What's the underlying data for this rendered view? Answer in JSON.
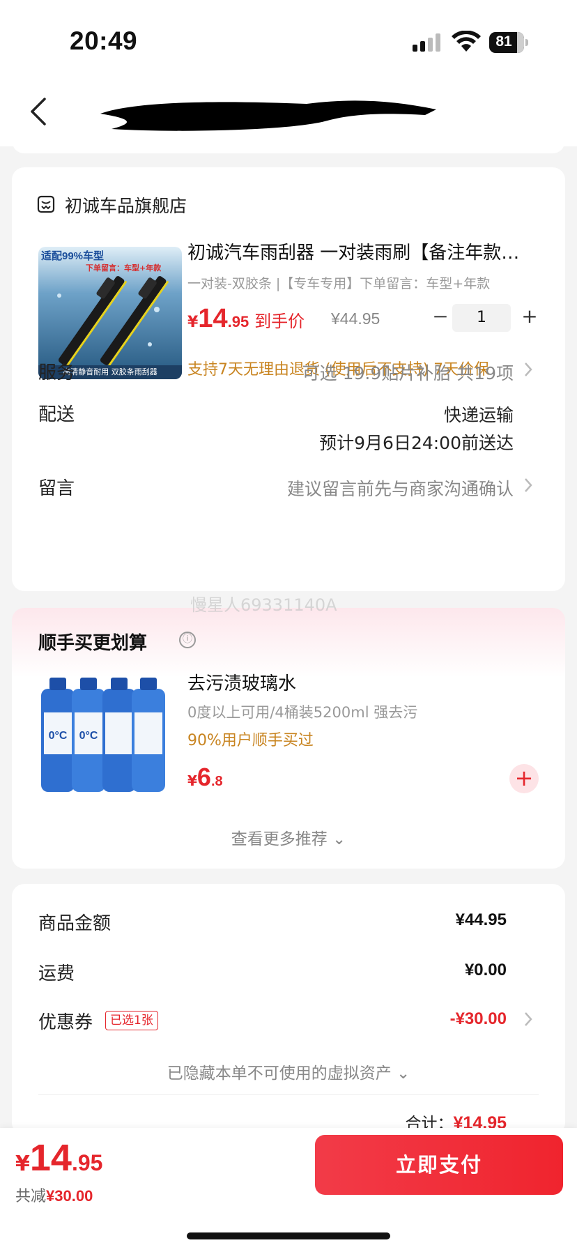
{
  "status": {
    "time": "20:49",
    "battery": "81"
  },
  "shop": {
    "name": "初诚车品旗舰店",
    "icon": "shop-icon"
  },
  "product": {
    "image_tag_top": "适配99%车型",
    "image_tag_note": "下单留言：车型+年款",
    "image_tag_bottom": "高清静音耐用  双胶条雨刮器",
    "title": "初诚汽车雨刮器 一对装雨刷【备注年款…",
    "spec": "一对装-双胶条 |【专车专用】下单留言：车型+年款",
    "currency": "¥",
    "price_int": "14",
    "price_dec": ".95",
    "price_label": "到手价",
    "original_price": "¥44.95",
    "qty_minus": "−",
    "quantity": "1",
    "qty_plus": "+",
    "support": "支持7天无理由退货 (使用后不支持)  7天价保"
  },
  "rows": {
    "service_label": "服务",
    "service_value": "可选 19.9贴片补胎 共19项",
    "delivery_label": "配送",
    "delivery_method": "快递运输",
    "delivery_eta": "预计9月6日24:00前送达",
    "message_label": "留言",
    "message_placeholder": "建议留言前先与商家沟通确认"
  },
  "recommend": {
    "watermark": "慢星人69331140A",
    "title": "顺手买更划算",
    "info_icon": "ⓘ",
    "item_name": "去污渍玻璃水",
    "item_desc": "0度以上可用/4桶装5200ml 强去污",
    "item_stat": "90%用户顺手买过",
    "currency": "¥",
    "price_int": "6",
    "price_dec": ".8",
    "add_label": "+",
    "more": "查看更多推荐 ⌄",
    "bottle_text": "0°C"
  },
  "summary": {
    "goods_label": "商品金额",
    "goods_value": "¥44.95",
    "shipping_label": "运费",
    "shipping_value": "¥0.00",
    "coupon_label": "优惠券",
    "coupon_tag": "已选1张",
    "coupon_value": "-¥30.00",
    "hidden_assets": "已隐藏本单不可使用的虚拟资产 ⌄",
    "total_label": "合计：",
    "total_value": "¥14.95"
  },
  "footer": {
    "currency": "¥",
    "price_int": "14",
    "price_dec": ".95",
    "save_label": "共减",
    "save_value": "¥30.00",
    "pay_label": "立即支付"
  },
  "colors": {
    "accent": "#e5262c",
    "orange": "#c88420"
  }
}
